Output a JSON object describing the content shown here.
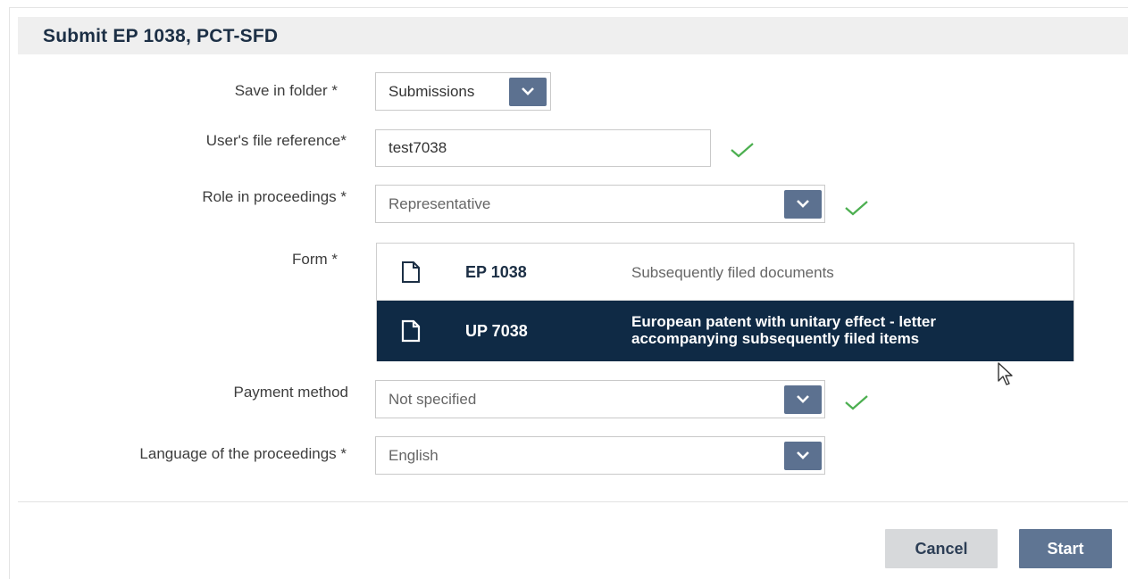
{
  "dialog": {
    "title": "Submit EP 1038, PCT-SFD"
  },
  "fields": {
    "save_in_folder": {
      "label": "Save in folder *",
      "value": "Submissions"
    },
    "file_reference": {
      "label": "User's file reference*",
      "value": "test7038"
    },
    "role": {
      "label": "Role in proceedings *",
      "value": "Representative"
    },
    "form": {
      "label": "Form *",
      "options": [
        {
          "code": "EP 1038",
          "description": "Subsequently filed documents",
          "selected": false
        },
        {
          "code": "UP 7038",
          "description_lines": [
            "European patent with unitary effect - letter",
            "accompanying subsequently filed items"
          ],
          "selected": true
        }
      ]
    },
    "payment_method": {
      "label": "Payment method",
      "value": "Not specified"
    },
    "language": {
      "label": "Language of the proceedings *",
      "value": "English"
    }
  },
  "buttons": {
    "cancel": "Cancel",
    "start": "Start"
  },
  "icons": {
    "dropdown": "chevron-down-icon",
    "valid": "checkmark-icon",
    "form": "document-icon",
    "cursor": "mouse-pointer-icon"
  },
  "colors": {
    "title": "#1c2f45",
    "dropdown_button": "#5c7190",
    "selected_row": "#0f2a45",
    "check": "#4caf50",
    "start_button": "#5f7593",
    "cancel_button": "#d7d9db"
  }
}
